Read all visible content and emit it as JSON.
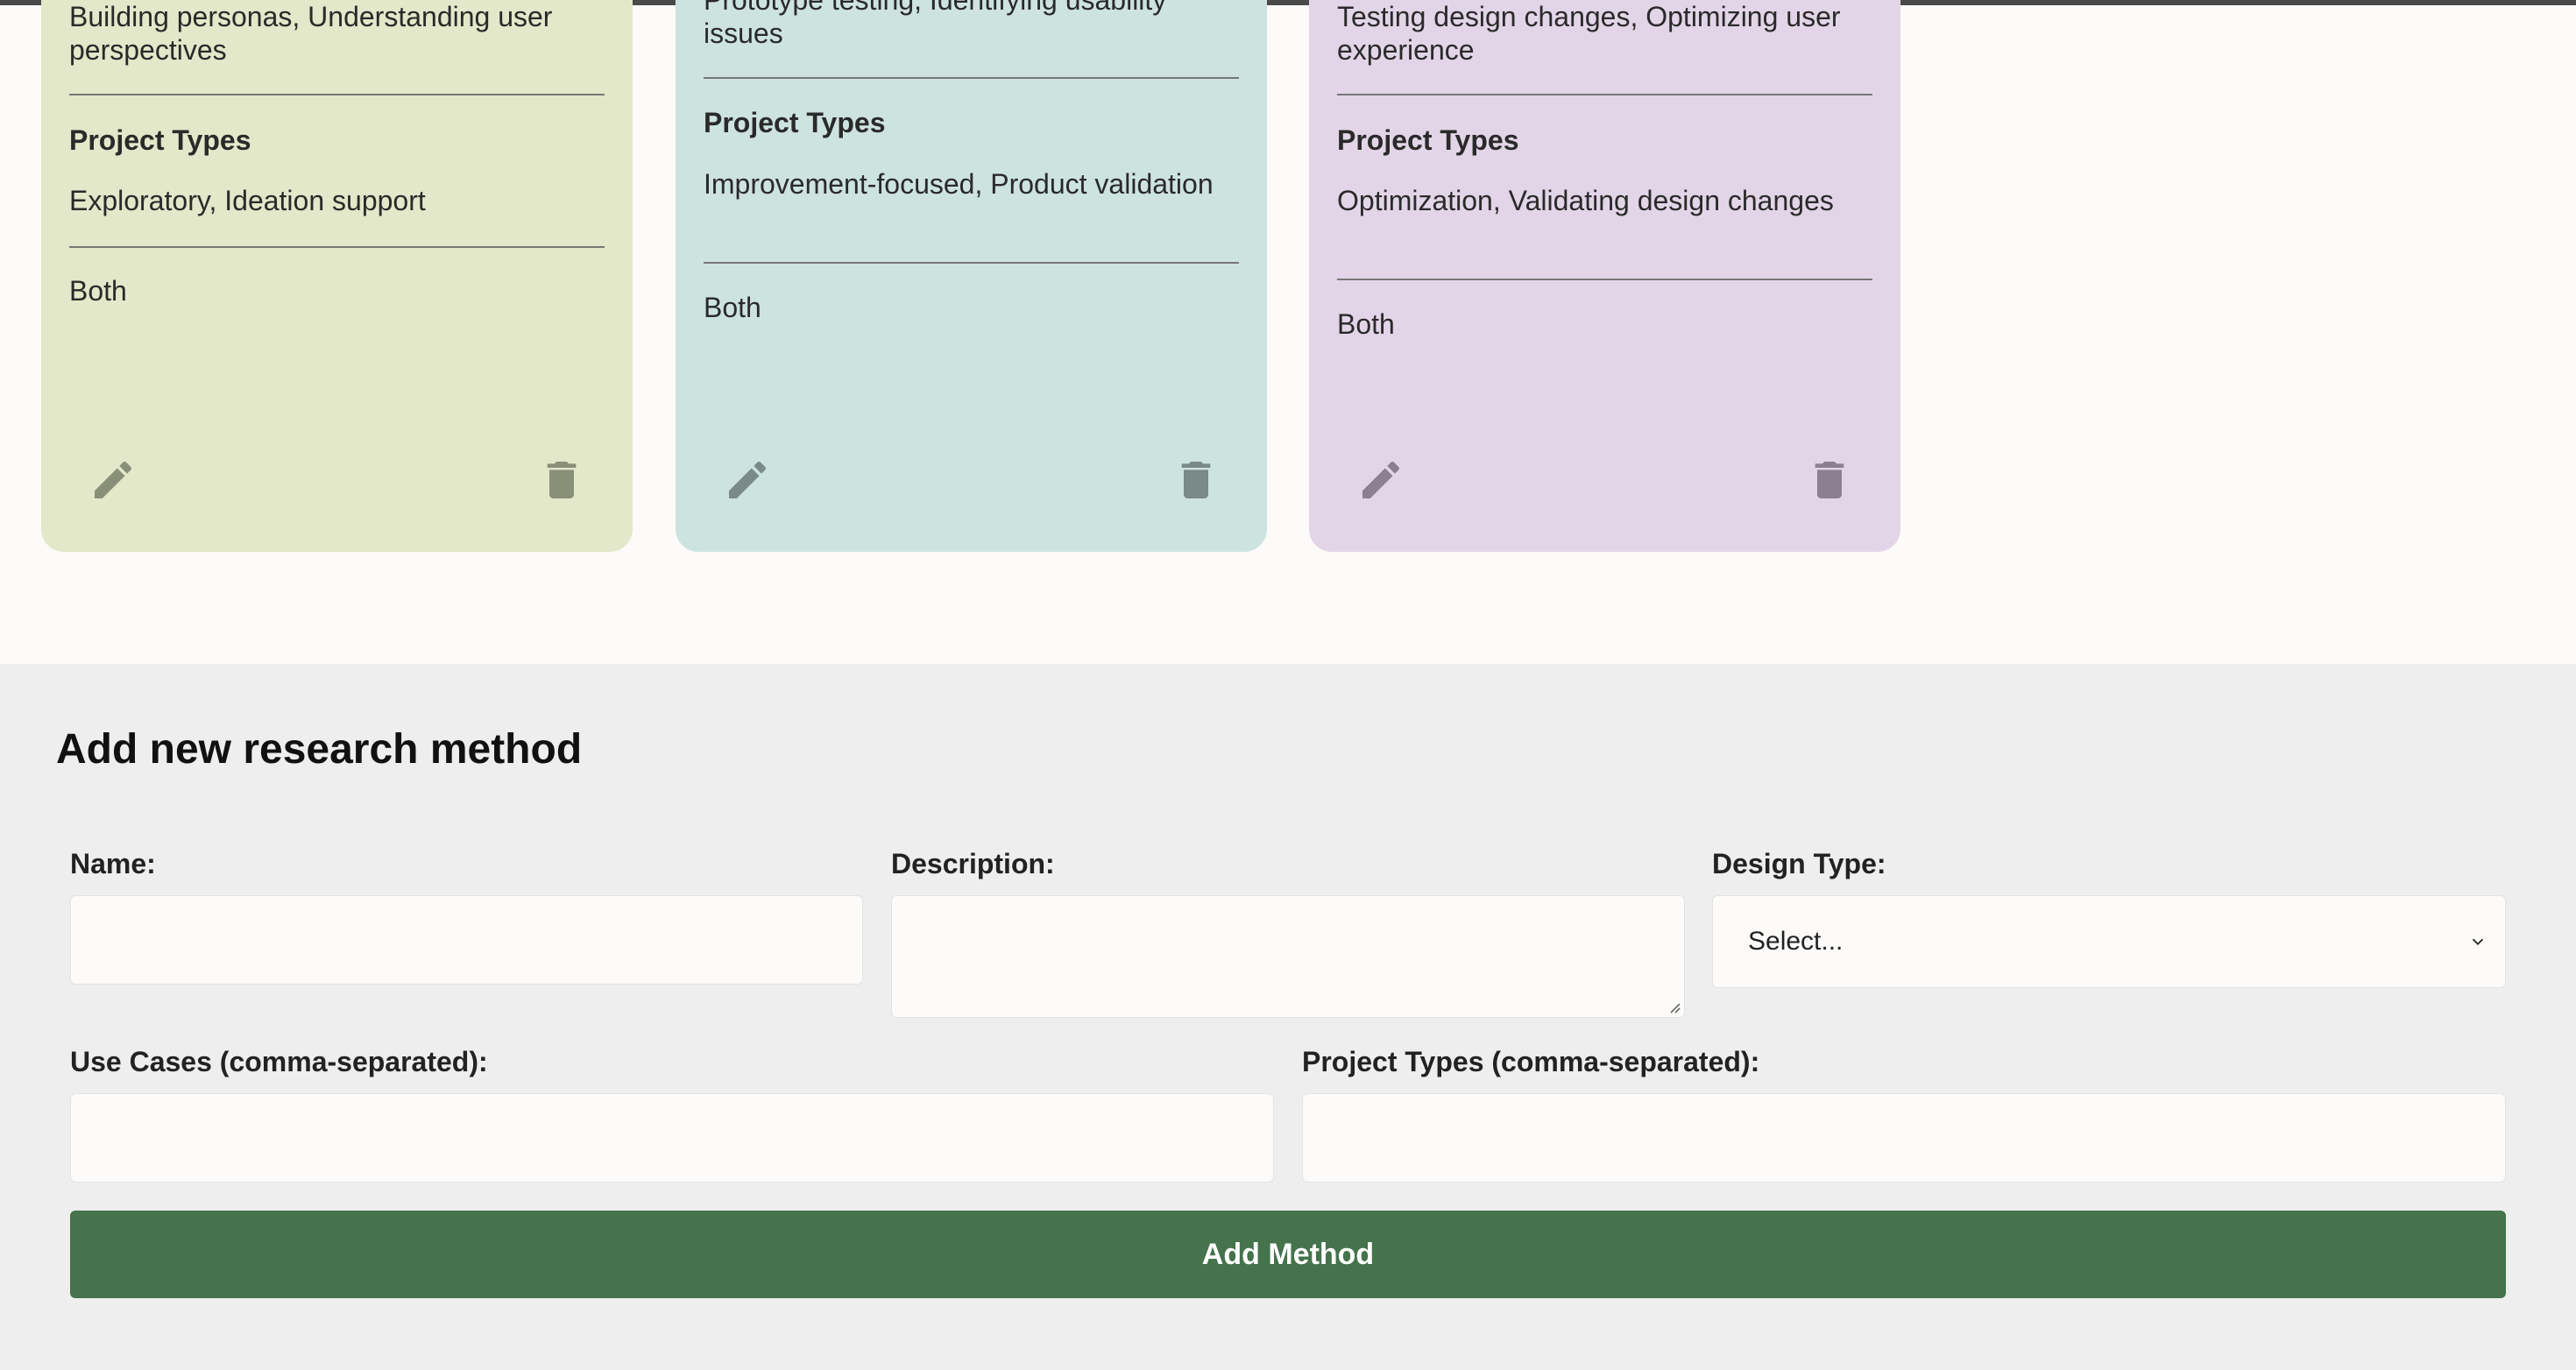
{
  "cards": [
    {
      "use_cases_text": "Building personas, Understanding user perspectives",
      "project_types_heading": "Project Types",
      "project_types_text": "Exploratory, Ideation support",
      "design_type": "Both",
      "color": "#e2e8c9"
    },
    {
      "use_cases_text": "Prototype testing, Identifying usability issues",
      "project_types_heading": "Project Types",
      "project_types_text": "Improvement-focused, Product validation",
      "design_type": "Both",
      "color": "#cde3df"
    },
    {
      "use_cases_text": "Testing design changes, Optimizing user experience",
      "project_types_heading": "Project Types",
      "project_types_text": "Optimization, Validating design changes",
      "design_type": "Both",
      "color": "#e3d5e8"
    }
  ],
  "icons": {
    "edit": "pencil-icon",
    "delete": "trash-icon"
  },
  "form": {
    "title": "Add new research method",
    "name_label": "Name:",
    "name_value": "",
    "description_label": "Description:",
    "description_value": "",
    "design_type_label": "Design Type:",
    "design_type_selected": "Select...",
    "use_cases_label": "Use Cases (comma-separated):",
    "use_cases_value": "",
    "project_types_label": "Project Types (comma-separated):",
    "project_types_value": "",
    "submit_label": "Add Method",
    "submit_color": "#44734c"
  }
}
